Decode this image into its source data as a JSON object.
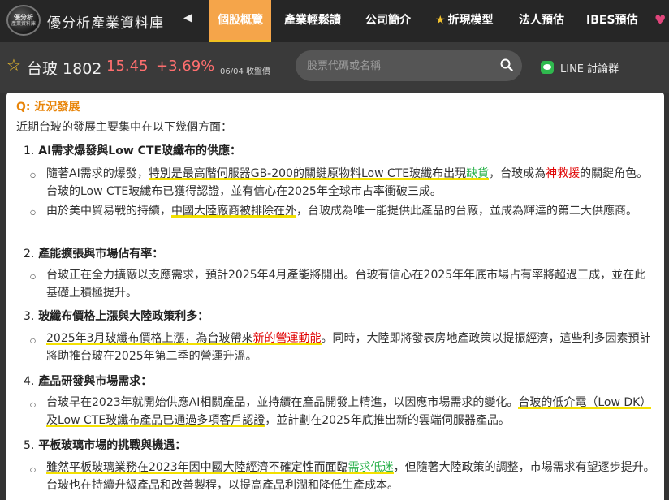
{
  "header": {
    "logo_line1": "優分析",
    "logo_line2": "產業資料庫",
    "site_title": "優分析產業資料庫",
    "prev_arrow": "◀",
    "tabs": [
      {
        "label": "個股概覽",
        "active": true
      },
      {
        "label": "產業輕鬆讀",
        "active": false
      },
      {
        "label": "公司簡介",
        "active": false
      },
      {
        "label": "折現模型",
        "active": false,
        "icon": "star-icon"
      },
      {
        "label": "法人預估",
        "active": false
      },
      {
        "label": "IBES預估",
        "active": false
      }
    ],
    "heart_icon": "heart-icon"
  },
  "quote": {
    "name": "台玻 1802",
    "price": "15.45",
    "change": "+3.69%",
    "date_label": "06/04 收盤價",
    "price_color": "#ff6f6f"
  },
  "search": {
    "placeholder": "股票代碼或名稱"
  },
  "line_button": {
    "label": "LINE 討論群"
  },
  "content": {
    "question": "Q: 近況發展",
    "intro": "近期台玻的發展主要集中在以下幾個方面：",
    "sections": [
      {
        "number": "1.",
        "title": "AI需求爆發與Low CTE玻纖布的供應：",
        "paragraphs": [
          {
            "p1": "隨著AI需求的爆發，",
            "p2": "特別是最高階伺服器GB-200的關鍵原物料Low CTE玻纖布出現",
            "p3": "缺貨",
            "p4": "，台玻成為",
            "p5": "神救援",
            "p6": "的關鍵角色。台玻的Low CTE玻纖布已獲得認證，並有信心在2025年全球市占率衝破三成。"
          },
          {
            "p1": "由於美中貿易戰的持續，",
            "p2": "中國大陸廠商被排除在外",
            "p3": "，台玻成為唯一能提供此產品的台廠，並成為輝達的第二大供應商。"
          }
        ]
      },
      {
        "number": "2.",
        "title": "產能擴張與市場佔有率：",
        "paragraphs": [
          {
            "p1": "台玻正在全力擴廠以支應需求，預計2025年4月產能將開出。台玻有信心在2025年年底市場占有率將超過三成，並在此基礎上積極提升。"
          }
        ]
      },
      {
        "number": "3.",
        "title": "玻纖布價格上漲與大陸政策利多：",
        "paragraphs": [
          {
            "p1": "2025年3月玻纖布價格上漲，為台玻帶來",
            "p2": "新的營運動能",
            "p3": "。同時，大陸即將發表房地產政策以提振經濟，這些利多因素預計將助推台玻在2025年第二季的營運升溫。"
          }
        ]
      },
      {
        "number": "4.",
        "title": "產品研發與市場需求：",
        "paragraphs": [
          {
            "p1": "台玻早在2023年就開始供應AI相關產品，並持續在產品開發上精進，以因應市場需求的變化。",
            "p2": "台玻的低介電（Low DK）及Low CTE玻纖布產品已通過多項客戶認證",
            "p3": "，並計劃在2025年底推出新的雲端伺服器產品。"
          }
        ]
      },
      {
        "number": "5.",
        "title": "平板玻璃市場的挑戰與機遇：",
        "paragraphs": [
          {
            "p1": "雖然平板玻璃業務在2023年因中國大陸經濟不確定性而面臨",
            "p2": "需求低迷",
            "p3": "，但隨著大陸政策的調整，市場需求有望逐步提升。台玻也在持續升級產品和改善製程，以提高產品利潤和降低生產成本。"
          }
        ]
      }
    ]
  },
  "colors": {
    "accent_tab": "#f5a54a",
    "highlight_red": "#e00000",
    "highlight_green": "#2bb24c",
    "underline_yellow": "#f3e000",
    "question_orange": "#e8850a"
  }
}
